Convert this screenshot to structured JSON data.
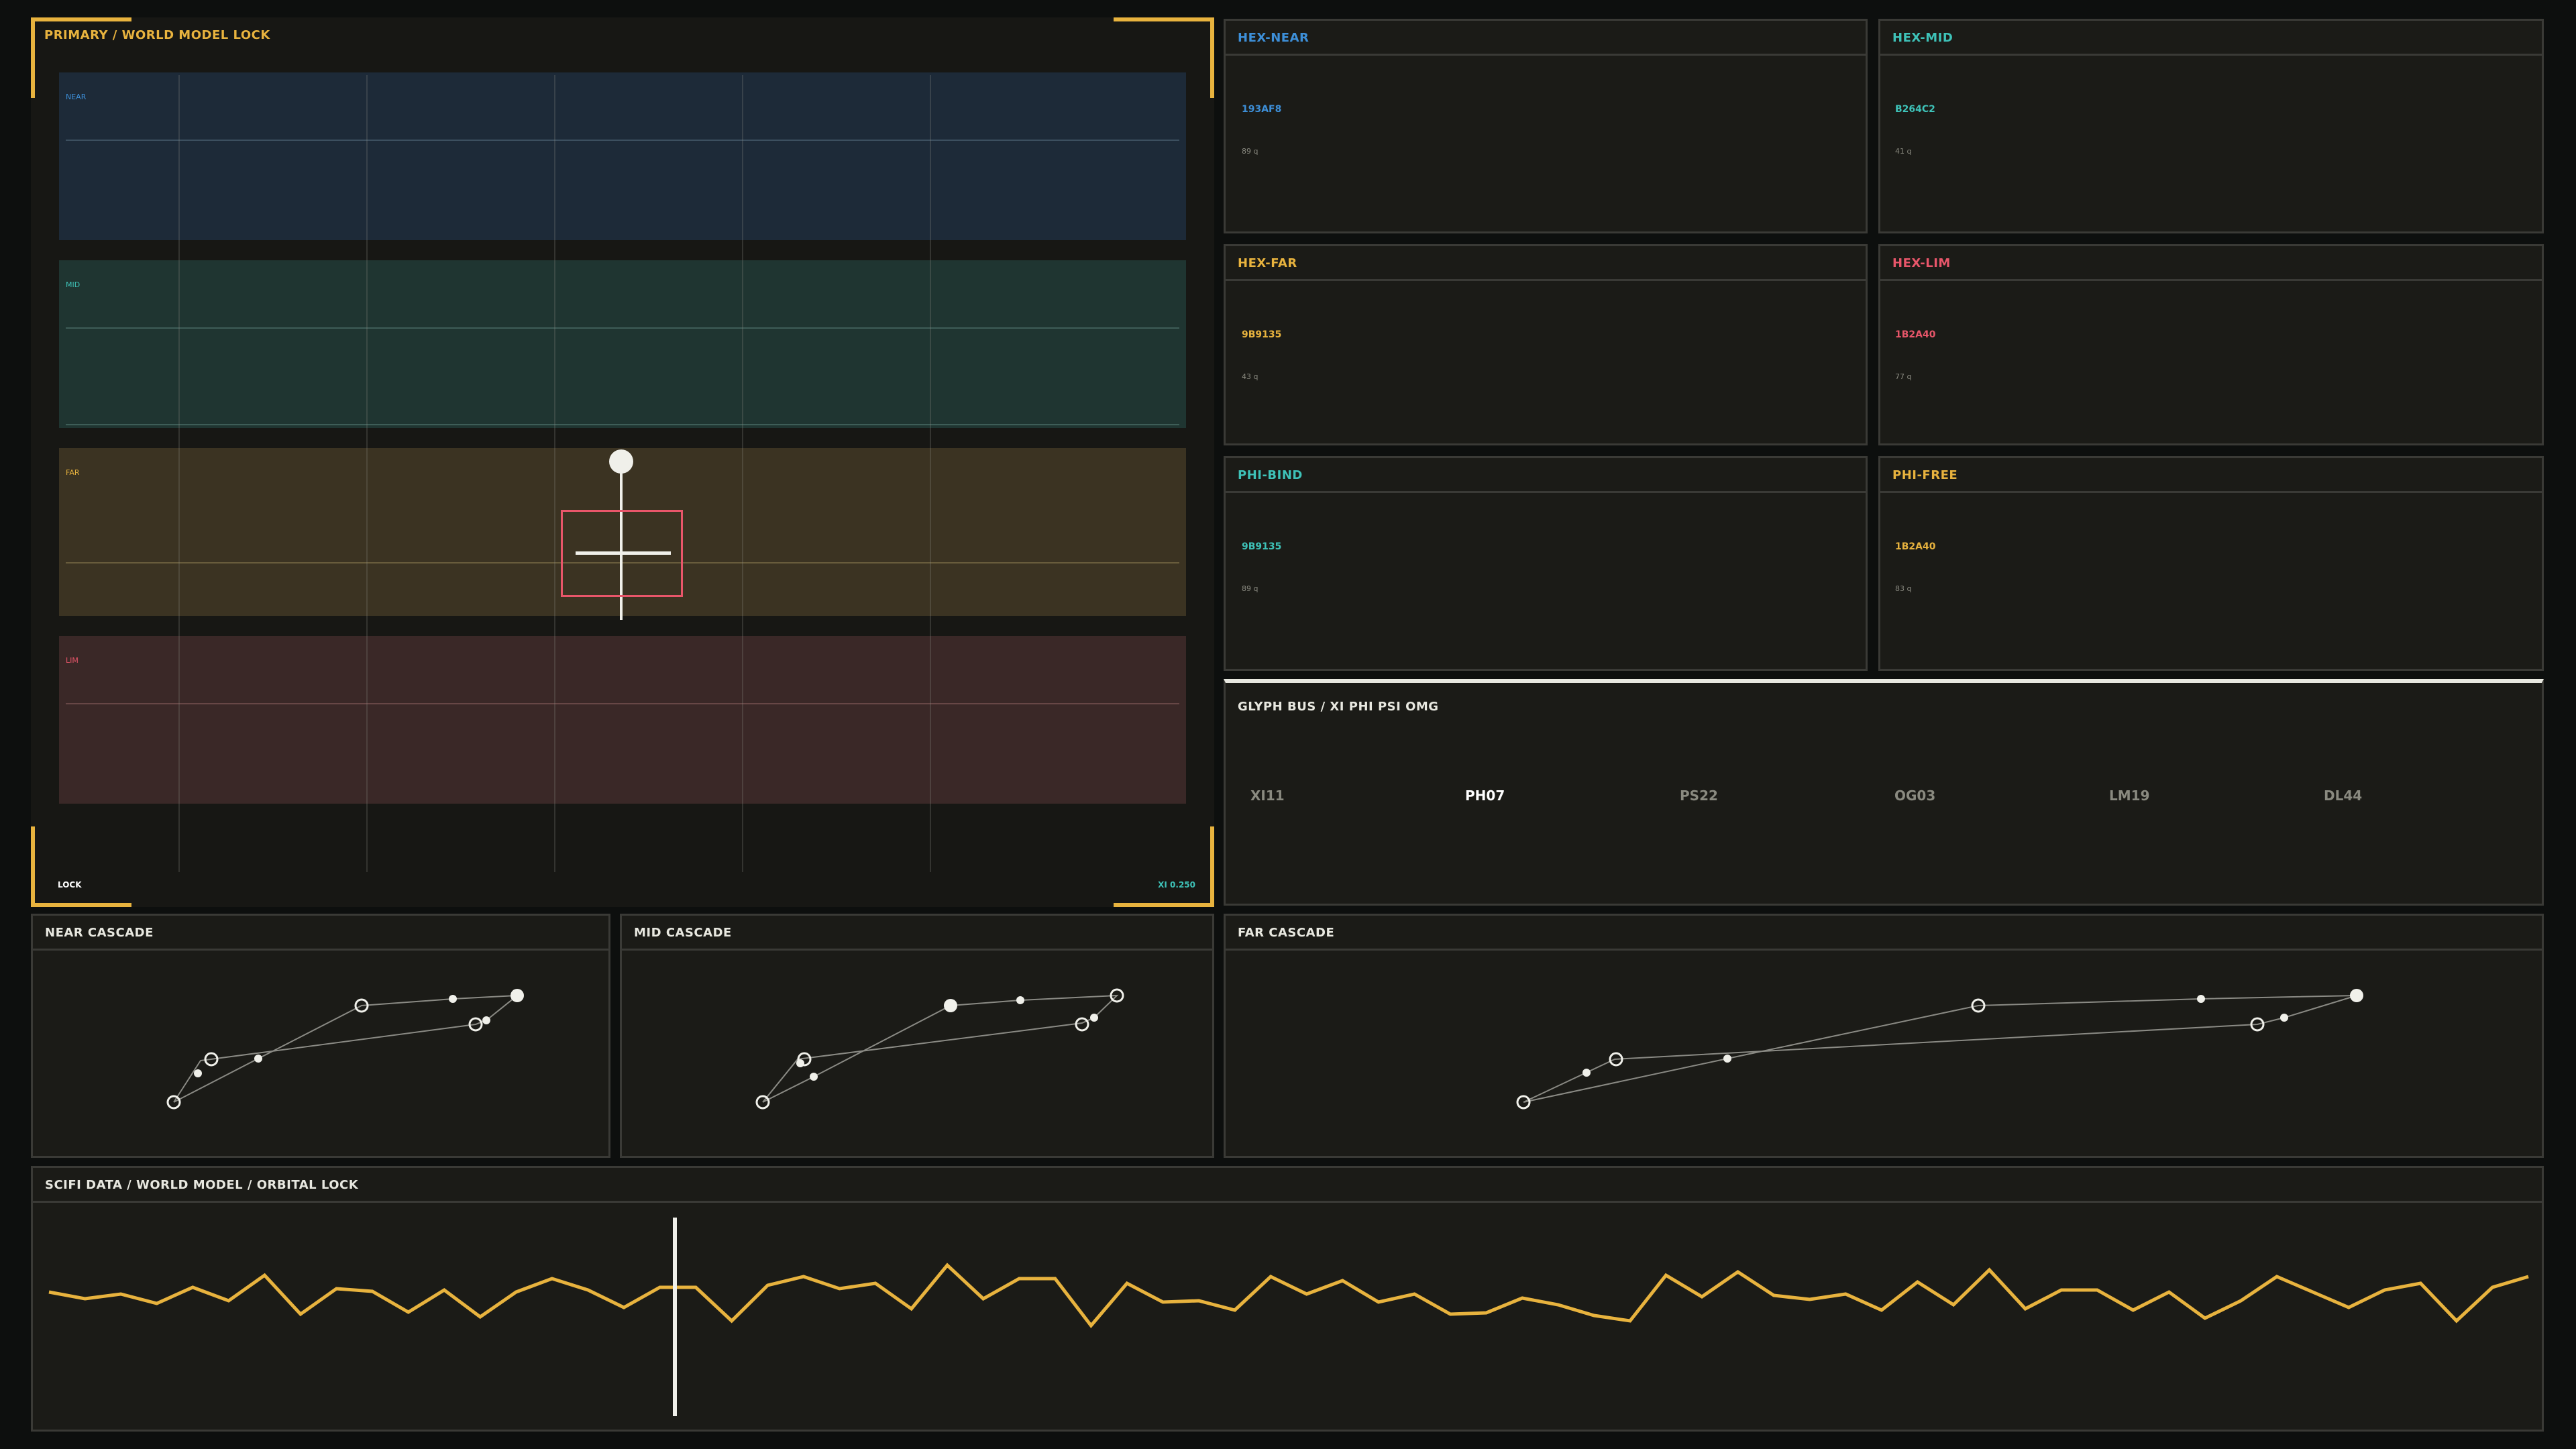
{
  "primary": {
    "title": "PRIMARY / WORLD MODEL LOCK",
    "bands": [
      {
        "name": "NEAR",
        "color": "#3d8fd8"
      },
      {
        "name": "MID",
        "color": "#3ec2b8"
      },
      {
        "name": "FAR",
        "color": "#e8b33e"
      },
      {
        "name": "LIM",
        "color": "#e8566a"
      }
    ],
    "lock_label": "LOCK",
    "xi_readout": "XI 0.250",
    "accent": "#e8b33e"
  },
  "hex_panels": [
    {
      "title": "HEX-NEAR",
      "code": "193AF8",
      "value": "89 q",
      "color": "#3d8fd8"
    },
    {
      "title": "HEX-MID",
      "code": "B264C2",
      "value": "41 q",
      "color": "#3ec2b8"
    },
    {
      "title": "HEX-FAR",
      "code": "9B9135",
      "value": "43 q",
      "color": "#e8b33e"
    },
    {
      "title": "HEX-LIM",
      "code": "1B2A40",
      "value": "77 q",
      "color": "#e8566a"
    },
    {
      "title": "PHI-BIND",
      "code": "9B9135",
      "value": "89 q",
      "color": "#3ec2b8"
    },
    {
      "title": "PHI-FREE",
      "code": "1B2A40",
      "value": "83 q",
      "color": "#e8b33e"
    }
  ],
  "glyph_bus": {
    "title": "GLYPH BUS / XI PHI PSI OMG",
    "glyphs": [
      "XI11",
      "PH07",
      "PS22",
      "OG03",
      "LM19",
      "DL44"
    ],
    "selected": "PH07"
  },
  "cascades": [
    {
      "title": "NEAR CASCADE"
    },
    {
      "title": "MID CASCADE"
    },
    {
      "title": "FAR CASCADE"
    }
  ],
  "timeline": {
    "title": "SCIFI DATA / WORLD MODEL / ORBITAL LOCK",
    "color": "#e8b33e",
    "series": [
      0.55,
      0.45,
      0.52,
      0.38,
      0.62,
      0.42,
      0.8,
      0.22,
      0.6,
      0.56,
      0.25,
      0.58,
      0.18,
      0.55,
      0.75,
      0.58,
      0.32,
      0.62,
      0.62,
      0.12,
      0.65,
      0.78,
      0.6,
      0.68,
      0.3,
      0.95,
      0.45,
      0.75,
      0.75,
      0.05,
      0.68,
      0.4,
      0.42,
      0.28,
      0.78,
      0.52,
      0.72,
      0.4,
      0.52,
      0.22,
      0.24,
      0.46,
      0.36,
      0.2,
      0.12,
      0.8,
      0.48,
      0.85,
      0.5,
      0.44,
      0.52,
      0.28,
      0.7,
      0.36,
      0.88,
      0.3,
      0.58,
      0.58,
      0.28,
      0.55,
      0.16,
      0.42,
      0.78,
      0.55,
      0.32,
      0.58,
      0.68,
      0.12,
      0.62,
      0.78
    ]
  }
}
